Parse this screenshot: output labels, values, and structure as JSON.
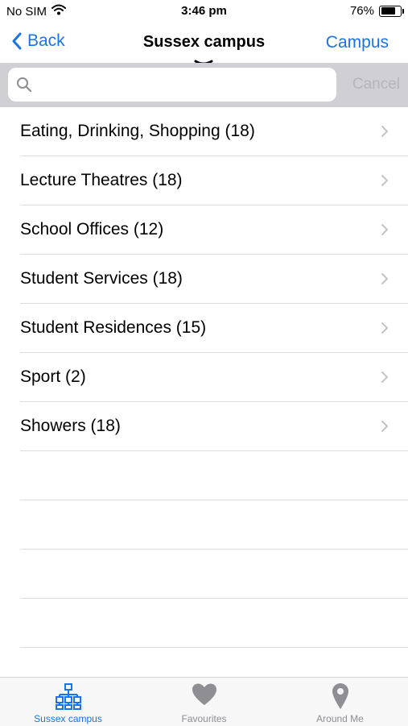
{
  "status_bar": {
    "carrier": "No SIM",
    "time": "3:46 pm",
    "battery_percent": "76%",
    "battery_level": 0.76
  },
  "nav": {
    "back_label": "Back",
    "title": "Sussex campus",
    "right_label": "Campus"
  },
  "search": {
    "value": "",
    "placeholder": "",
    "cancel_label": "Cancel"
  },
  "list": {
    "items": [
      {
        "label": "Eating, Drinking, Shopping (18)"
      },
      {
        "label": "Lecture Theatres (18)"
      },
      {
        "label": "School Offices (12)"
      },
      {
        "label": "Student Services (18)"
      },
      {
        "label": "Student Residences (15)"
      },
      {
        "label": "Sport (2)"
      },
      {
        "label": "Showers (18)"
      }
    ]
  },
  "tab_bar": {
    "tabs": [
      {
        "label": "Sussex campus",
        "icon": "hierarchy-icon",
        "active": true
      },
      {
        "label": "Favourites",
        "icon": "heart-icon",
        "active": false
      },
      {
        "label": "Around Me",
        "icon": "location-pin-icon",
        "active": false
      }
    ]
  },
  "colors": {
    "accent": "#1a73e8",
    "inactive": "#8e8e93",
    "search_background": "#cfcfd4"
  }
}
